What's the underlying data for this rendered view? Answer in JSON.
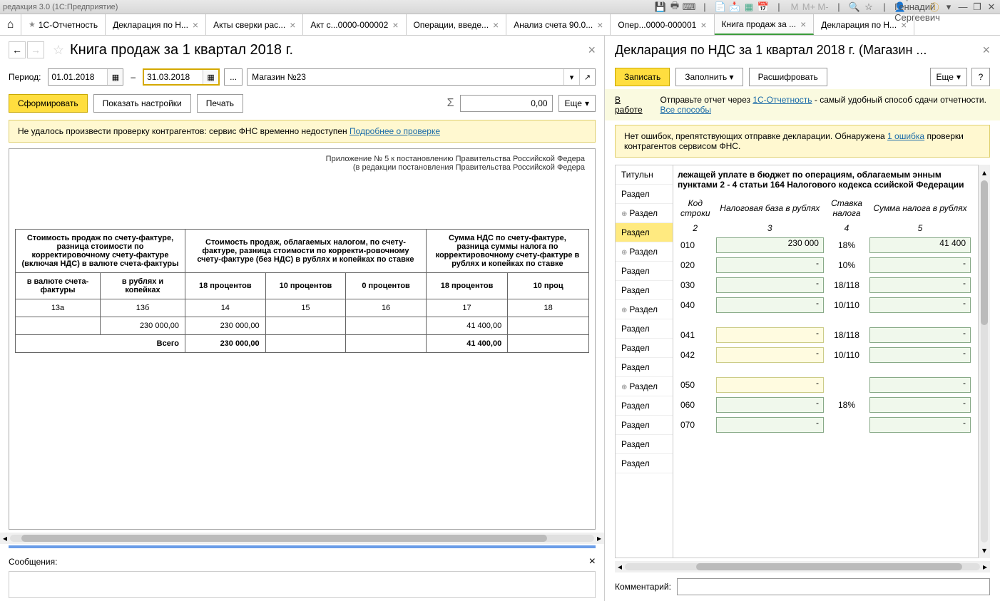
{
  "app": {
    "title": "редакция 3.0  (1С:Предприятие)",
    "user": "Абрамов Геннадий Сергеевич"
  },
  "toolbar_icons": [
    "save",
    "print",
    "calc",
    "idk1",
    "doc",
    "mail",
    "table",
    "calendar",
    "M",
    "M+",
    "M-",
    "zoom",
    "star",
    "user",
    "info",
    "line",
    "min",
    "restore",
    "close"
  ],
  "tabs": [
    {
      "label": "1С-Отчетность",
      "star": true,
      "close": false
    },
    {
      "label": "Декларация по Н...",
      "close": true
    },
    {
      "label": "Акты сверки рас...",
      "close": true
    },
    {
      "label": "Акт с...0000-000002",
      "close": true
    },
    {
      "label": "Операции, введе...",
      "close": true
    },
    {
      "label": "Анализ счета 90.0...",
      "close": true
    },
    {
      "label": "Опер...0000-000001",
      "close": true
    },
    {
      "label": "Книга продаж за ...",
      "close": true,
      "active": true
    },
    {
      "label": "Декларация по Н...",
      "close": true
    }
  ],
  "left": {
    "title": "Книга продаж за 1 квартал 2018 г.",
    "period_label": "Период:",
    "date_from": "01.01.2018",
    "date_to": "31.03.2018",
    "org": "Магазин №23",
    "btn_form": "Сформировать",
    "btn_settings": "Показать настройки",
    "btn_print": "Печать",
    "sum": "0,00",
    "btn_more": "Еще",
    "warning": "Не удалось произвести проверку контрагентов: сервис ФНС временно недоступен ",
    "warning_link": "Подробнее о проверке",
    "ann1": "Приложение № 5 к постановлению Правительства Российской Федера",
    "ann2": "(в редакции постановления Правительства Российской Федера",
    "table": {
      "h1": "Стоимость продаж по счету-фактуре, разница стоимости по корректировочному счету-фактуре (включая НДС) в валюте счета-фактуры",
      "h2": "Стоимость продаж, облагаемых налогом, по счету-фактуре, разница стоимости по корректи-ровочному счету-фактуре (без НДС) в рублях и копейках по ставке",
      "h3": "Сумма НДС по счету-фактуре, разница суммы налога по корректировочному счету-фактуре в рублях и копейках по ставке",
      "sub": [
        "в валюте счета-фактуры",
        "в рублях и копейках",
        "18 процентов",
        "10 процентов",
        "0 процентов",
        "18 процентов",
        "10 проц"
      ],
      "cols": [
        "13а",
        "13б",
        "14",
        "15",
        "16",
        "17",
        "18"
      ],
      "row": [
        "",
        "230 000,00",
        "230 000,00",
        "",
        "",
        "41 400,00",
        ""
      ],
      "total_label": "Всего",
      "total": [
        "230 000,00",
        "",
        "",
        "41 400,00",
        ""
      ]
    },
    "messages_label": "Сообщения:"
  },
  "right": {
    "title": "Декларация по НДС за 1 квартал 2018 г. (Магазин ...",
    "btn_write": "Записать",
    "btn_fill": "Заполнить",
    "btn_decode": "Расшифровать",
    "btn_more": "Еще",
    "status": "В работе",
    "info_text1": "Отправьте отчет через ",
    "info_link1": "1С-Отчетность",
    "info_text2": " - самый удобный способ сдачи отчетности. ",
    "info_link2": "Все способы",
    "noerr_text1": "Нет ошибок, препятствующих отправке декларации. Обнаружена ",
    "noerr_link": "1 ошибка",
    "noerr_text2": " проверки контрагентов сервисом ФНС.",
    "sections": [
      "Титульн",
      "Раздел",
      "Раздел",
      "Раздел",
      "Раздел",
      "Раздел",
      "Раздел",
      "Раздел",
      "Раздел",
      "Раздел",
      "Раздел",
      "Раздел",
      "Раздел",
      "Раздел",
      "Раздел",
      "Раздел"
    ],
    "section_exp": [
      false,
      false,
      true,
      false,
      true,
      false,
      false,
      true,
      false,
      false,
      false,
      true,
      false,
      false,
      false,
      false
    ],
    "section_active": 3,
    "heading": "лежащей уплате в бюджет по операциям, облагаемым энным пунктами 2 - 4 статьи 164 Налогового кодекса ссийской Федерации",
    "cols": [
      "Код строки",
      "Налоговая база в рублях",
      "Ставка налога",
      "Сумма налога в рублях"
    ],
    "colnums": [
      "2",
      "3",
      "4",
      "5"
    ],
    "rows": [
      {
        "code": "010",
        "base": "230 000",
        "rate": "18%",
        "tax": "41 400",
        "base_yellow": false
      },
      {
        "code": "020",
        "base": "-",
        "rate": "10%",
        "tax": "-",
        "base_yellow": false
      },
      {
        "code": "030",
        "base": "-",
        "rate": "18/118",
        "tax": "-",
        "base_yellow": false
      },
      {
        "code": "040",
        "base": "-",
        "rate": "10/110",
        "tax": "-",
        "base_yellow": false
      },
      {
        "gap": true
      },
      {
        "code": "041",
        "base": "-",
        "rate": "18/118",
        "tax": "-",
        "base_yellow": true
      },
      {
        "code": "042",
        "base": "-",
        "rate": "10/110",
        "tax": "-",
        "base_yellow": true
      },
      {
        "gap": true
      },
      {
        "code": "050",
        "base": "-",
        "rate": "",
        "tax": "-",
        "base_yellow": true
      },
      {
        "code": "060",
        "base": "-",
        "rate": "18%",
        "tax": "-",
        "base_yellow": false
      },
      {
        "code": "070",
        "base": "-",
        "rate": "",
        "tax": "-",
        "base_yellow": false
      }
    ],
    "comment_label": "Комментарий:"
  }
}
